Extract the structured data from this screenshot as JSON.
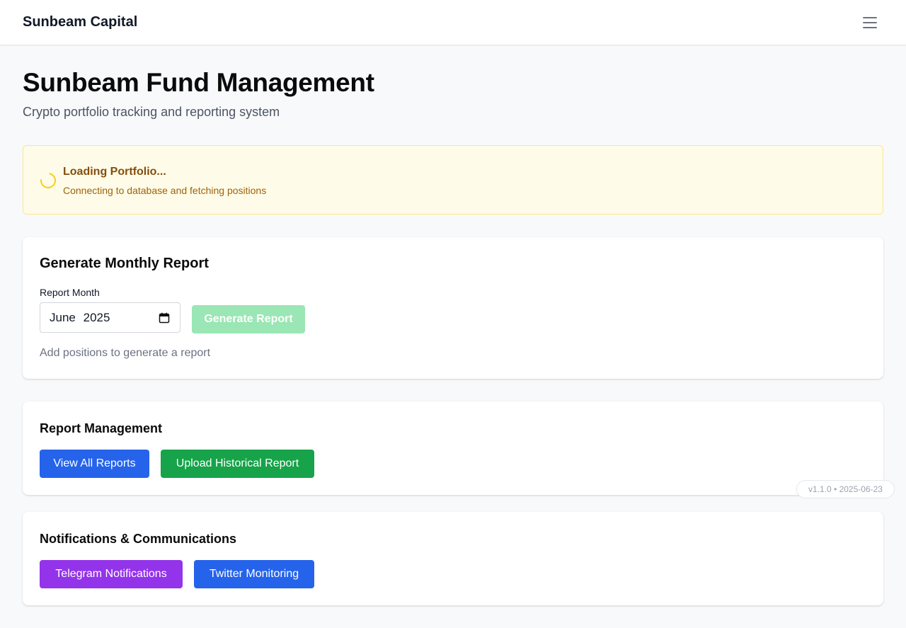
{
  "header": {
    "brand": "Sunbeam Capital",
    "menu_icon": "hamburger-menu-icon"
  },
  "page": {
    "title": "Sunbeam Fund Management",
    "subtitle": "Crypto portfolio tracking and reporting system"
  },
  "alert": {
    "title": "Loading Portfolio...",
    "message": "Connecting to database and fetching positions",
    "icon": "loading-spinner-icon"
  },
  "generate_report": {
    "title": "Generate Monthly Report",
    "month_label": "Report Month",
    "month_value_month": "June",
    "month_value_year": "2025",
    "button_label": "Generate Report",
    "button_disabled": true,
    "hint": "Add positions to generate a report"
  },
  "report_management": {
    "title": "Report Management",
    "buttons": [
      {
        "label": "View All Reports"
      },
      {
        "label": "Upload Historical Report"
      }
    ]
  },
  "notifications": {
    "title": "Notifications & Communications",
    "buttons": [
      {
        "label": "Telegram Notifications"
      },
      {
        "label": "Twitter Monitoring"
      }
    ]
  },
  "version_badge": "v1.1.0 • 2025-06-23",
  "colors": {
    "primary_blue": "#2563eb",
    "green": "#16a34a",
    "disabled_green": "#9ae6b4",
    "purple": "#9333ea",
    "alert_bg": "#fefce8",
    "alert_border": "#fde68a",
    "alert_text": "#854d0e"
  }
}
